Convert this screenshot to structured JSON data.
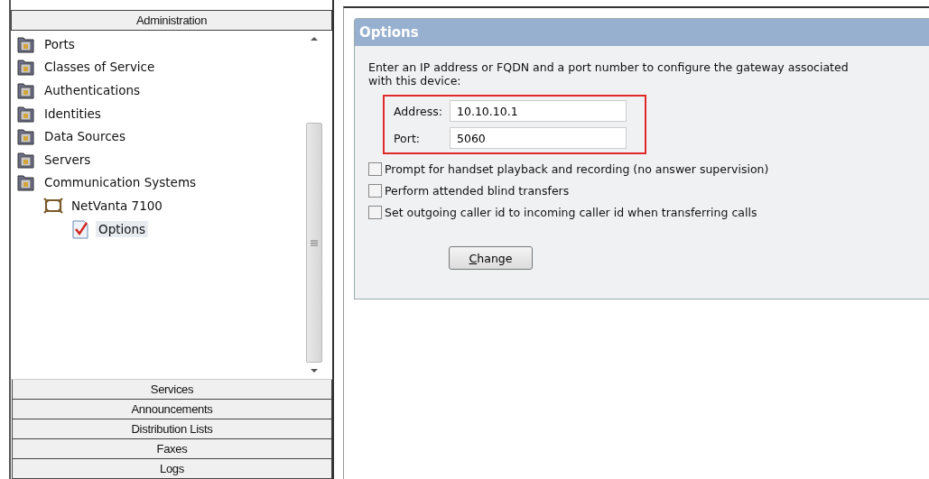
{
  "sidebar": {
    "header": "Administration",
    "tree": [
      {
        "label": "Ports",
        "kind": "folder",
        "selected": false
      },
      {
        "label": "Classes of Service",
        "kind": "folder",
        "selected": false
      },
      {
        "label": "Authentications",
        "kind": "folder",
        "selected": false
      },
      {
        "label": "Identities",
        "kind": "folder",
        "selected": false
      },
      {
        "label": "Data Sources",
        "kind": "folder",
        "selected": false
      },
      {
        "label": "Servers",
        "kind": "folder",
        "selected": false
      },
      {
        "label": "Communication Systems",
        "kind": "folder",
        "selected": false,
        "children": [
          {
            "label": "NetVanta 7100",
            "kind": "device",
            "selected": false,
            "children": [
              {
                "label": "Options",
                "kind": "options",
                "selected": true
              }
            ]
          }
        ]
      }
    ],
    "sections": [
      "Services",
      "Announcements",
      "Distribution Lists",
      "Faxes",
      "Logs"
    ]
  },
  "options": {
    "title": "Options",
    "description": "Enter an IP address or FQDN and a port number to configure the gateway associated with this device:",
    "fields_highlighted": true,
    "fields": [
      {
        "label": "Address:",
        "value": "10.10.10.1"
      },
      {
        "label": "Port:",
        "value": "5060"
      }
    ],
    "checkboxes": [
      {
        "label": "Prompt for handset playback and recording (no answer supervision)",
        "checked": false
      },
      {
        "label": "Perform attended blind transfers",
        "checked": false
      },
      {
        "label": "Set outgoing caller id to incoming caller id when transferring calls",
        "checked": false
      }
    ],
    "button": "Change"
  }
}
